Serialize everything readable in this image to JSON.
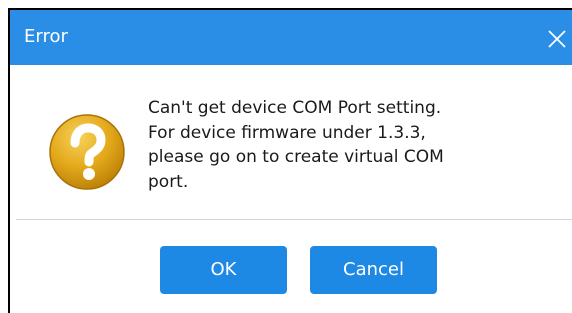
{
  "dialog": {
    "title": "Error",
    "message": "Can't get device COM Port setting.\nFor device firmware under 1.3.3,\nplease go on to create virtual COM\nport.",
    "icon": "question-icon",
    "buttons": {
      "ok_label": "OK",
      "cancel_label": "Cancel"
    }
  },
  "colors": {
    "titlebar": "#2a8ee6",
    "button": "#1e88e5",
    "icon_gold": "#e3a81a"
  }
}
